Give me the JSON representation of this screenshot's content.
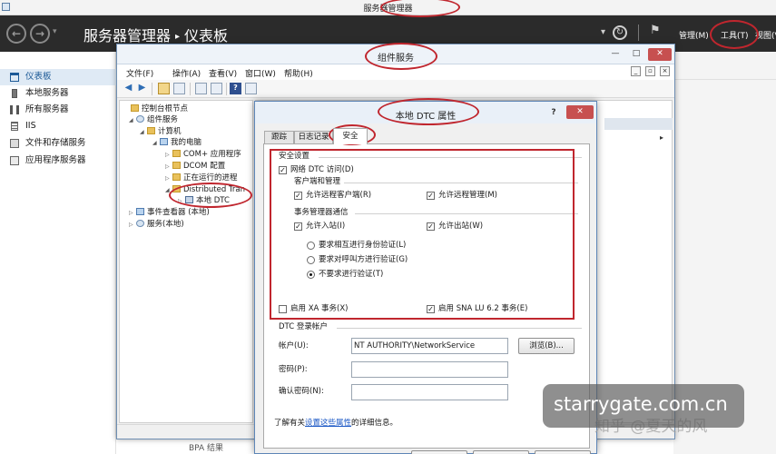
{
  "server_manager": {
    "window_title": "服务器管理器",
    "breadcrumb": {
      "app": "服务器管理器",
      "separator": "▸",
      "page": "仪表板"
    },
    "nav": {
      "back": "←",
      "forward": "→",
      "dropdown": "▾"
    },
    "header_icons": {
      "dropdown": "▾",
      "refresh": "↻",
      "flag": "⚑"
    },
    "menus": {
      "manage": "管理(M)",
      "tools": "工具(T)",
      "view": "视图(V)"
    },
    "sidebar": [
      {
        "label": "仪表板",
        "icon": "dashboard-icon",
        "active": true
      },
      {
        "label": "本地服务器",
        "icon": "server-icon",
        "active": false
      },
      {
        "label": "所有服务器",
        "icon": "servers-icon",
        "active": false
      },
      {
        "label": "IIS",
        "icon": "iis-icon",
        "active": false
      },
      {
        "label": "文件和存储服务",
        "icon": "file-storage-icon",
        "active": false
      },
      {
        "label": "应用程序服务器",
        "icon": "app-server-icon",
        "active": false
      }
    ],
    "bottom_stub": "BPA 结果"
  },
  "component_services": {
    "title": "组件服务",
    "window_buttons": {
      "minimize": "—",
      "maximize": "□",
      "close": "✕"
    },
    "menubar": [
      "文件(F)",
      "操作(A)",
      "查看(V)",
      "窗口(W)",
      "帮助(H)"
    ],
    "mdi_buttons": [
      "_",
      "▫",
      "×"
    ],
    "toolbar": {
      "back": "◀",
      "forward": "▶",
      "help": "?"
    },
    "tree": [
      {
        "label": "控制台根节点",
        "toggle": "",
        "icon": "folder"
      },
      {
        "label": "组件服务",
        "toggle": "◢",
        "icon": "gear"
      },
      {
        "label": "计算机",
        "toggle": "◢",
        "icon": "folder"
      },
      {
        "label": "我的电脑",
        "toggle": "◢",
        "icon": "comp"
      },
      {
        "label": "COM+ 应用程序",
        "toggle": "▷",
        "icon": "folder"
      },
      {
        "label": "DCOM 配置",
        "toggle": "▷",
        "icon": "folder"
      },
      {
        "label": "正在运行的进程",
        "toggle": "▷",
        "icon": "folder"
      },
      {
        "label": "Distributed Tran",
        "toggle": "◢",
        "icon": "folder"
      },
      {
        "label": "本地 DTC",
        "toggle": "▷",
        "icon": "dtc"
      },
      {
        "label": "事件查看器 (本地)",
        "toggle": "▷",
        "icon": "comp"
      },
      {
        "label": "服务(本地)",
        "toggle": "▷",
        "icon": "gear"
      }
    ],
    "actions_arrow": "▸"
  },
  "dtc_dialog": {
    "title": "本地 DTC 属性",
    "help": "?",
    "close": "✕",
    "tabs": [
      "跟踪",
      "日志记录",
      "安全"
    ],
    "security": {
      "section_title": "安全设置",
      "network_dtc_access": {
        "label": "网络 DTC 访问(D)",
        "checked": true
      },
      "client_admin": {
        "title": "客户端和管理",
        "allow_remote_clients": {
          "label": "允许远程客户端(R)",
          "checked": true
        },
        "allow_remote_admin": {
          "label": "允许远程管理(M)",
          "checked": true
        }
      },
      "tm_comm": {
        "title": "事务管理器通信",
        "allow_inbound": {
          "label": "允许入站(I)",
          "checked": true
        },
        "allow_outbound": {
          "label": "允许出站(W)",
          "checked": true
        },
        "auth_options": [
          {
            "label": "要求相互进行身份验证(L)",
            "selected": false
          },
          {
            "label": "要求对呼叫方进行验证(G)",
            "selected": false
          },
          {
            "label": "不要求进行验证(T)",
            "selected": true
          }
        ]
      },
      "enable_xa": {
        "label": "启用 XA 事务(X)",
        "checked": false
      },
      "enable_sna": {
        "label": "启用 SNA LU 6.2 事务(E)",
        "checked": true
      },
      "check_mark": "✓"
    },
    "logon_account": {
      "title": "DTC 登录帐户",
      "account_label": "帐户(U):",
      "account_value": "NT AUTHORITY\\NetworkService",
      "browse_button": "浏览(B)...",
      "password_label": "密码(P):",
      "password_value": "",
      "confirm_label": "确认密码(N):",
      "confirm_value": ""
    },
    "info": {
      "prefix": "了解有关",
      "link": "设置这些属性",
      "suffix": "的详细信息。"
    }
  },
  "watermark": {
    "site": "starrygate.com.cn",
    "zhihu": "知乎 @夏天的风"
  },
  "colors": {
    "header_bg": "#2b2b2b",
    "accent": "#1d5a97",
    "close_red": "#c75050",
    "annotation_red": "#c0262e"
  }
}
